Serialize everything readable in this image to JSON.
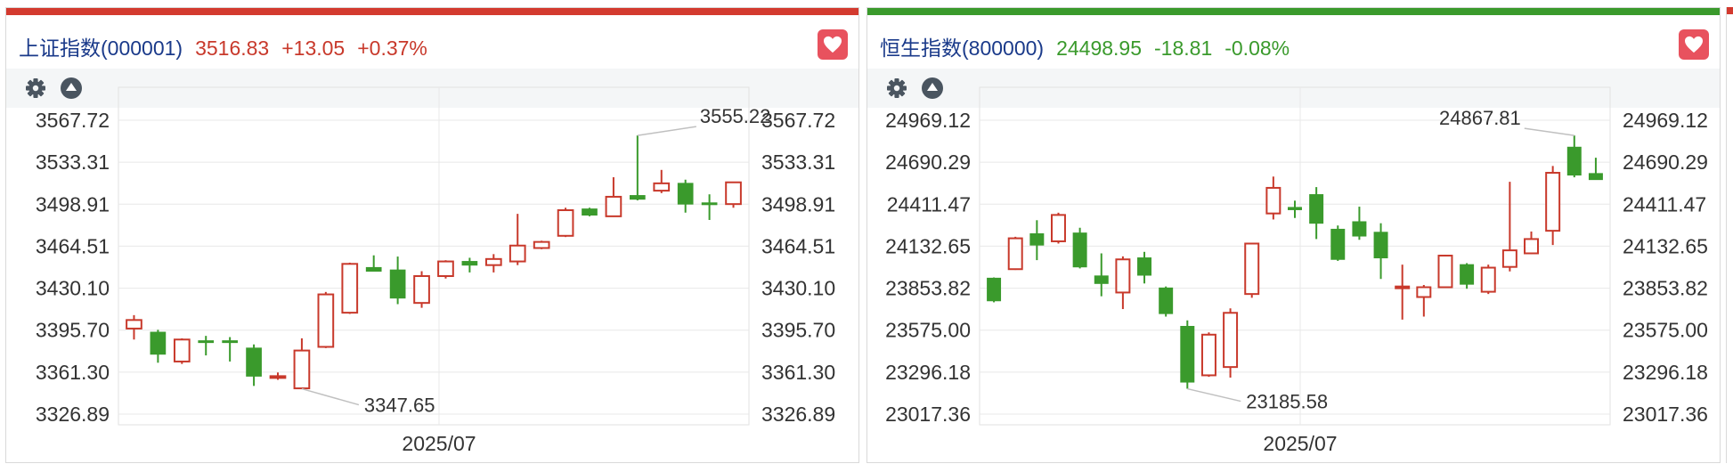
{
  "colors": {
    "up": "#c8392b",
    "down": "#3a9a2c",
    "up_bar": "#d33a2f",
    "down_bar": "#3a9a2c",
    "name": "#1a3a8a",
    "fav_bg": "#e8525e"
  },
  "icons": {
    "settings": "gear-icon",
    "collapse": "triangle-up-icon",
    "favorite": "heart-icon"
  },
  "panels": [
    {
      "name": "上证指数(000001)",
      "price": "3516.83",
      "change": "+13.05",
      "pct": "+0.37%",
      "direction": "up",
      "x_label": "2025/07",
      "y_ticks": [
        "3567.72",
        "3533.31",
        "3498.91",
        "3464.51",
        "3430.10",
        "3395.70",
        "3361.30",
        "3326.89"
      ],
      "high_label": "3555.22",
      "low_label": "3347.65"
    },
    {
      "name": "恒生指数(800000)",
      "price": "24498.95",
      "change": "-18.81",
      "pct": "-0.08%",
      "direction": "down",
      "x_label": "2025/07",
      "y_ticks": [
        "24969.12",
        "24690.29",
        "24411.47",
        "24132.65",
        "23853.82",
        "23575.00",
        "23296.18",
        "23017.36"
      ],
      "high_label": "24867.81",
      "low_label": "23185.58"
    }
  ],
  "chart_data": [
    {
      "type": "candlestick",
      "title": "上证指数(000001)",
      "ylim": [
        3326.89,
        3567.72
      ],
      "y_ticks": [
        3567.72,
        3533.31,
        3498.91,
        3464.51,
        3430.1,
        3395.7,
        3361.3,
        3326.89
      ],
      "x_label": "2025/07",
      "grid": true,
      "candles": [
        {
          "o": 3397,
          "h": 3408,
          "l": 3388,
          "c": 3404
        },
        {
          "o": 3394,
          "h": 3396,
          "l": 3369,
          "c": 3376
        },
        {
          "o": 3370,
          "h": 3389,
          "l": 3368,
          "c": 3388
        },
        {
          "o": 3387,
          "h": 3391,
          "l": 3375,
          "c": 3386
        },
        {
          "o": 3387,
          "h": 3390,
          "l": 3370,
          "c": 3386
        },
        {
          "o": 3381,
          "h": 3384,
          "l": 3350,
          "c": 3358
        },
        {
          "o": 3357,
          "h": 3361,
          "l": 3355,
          "c": 3358
        },
        {
          "o": 3348,
          "h": 3389,
          "l": 3347.65,
          "c": 3379
        },
        {
          "o": 3382,
          "h": 3427,
          "l": 3381,
          "c": 3425
        },
        {
          "o": 3410,
          "h": 3451,
          "l": 3409,
          "c": 3450
        },
        {
          "o": 3447,
          "h": 3457,
          "l": 3444,
          "c": 3444
        },
        {
          "o": 3445,
          "h": 3456,
          "l": 3417,
          "c": 3422
        },
        {
          "o": 3418,
          "h": 3444,
          "l": 3414,
          "c": 3440
        },
        {
          "o": 3440,
          "h": 3453,
          "l": 3438,
          "c": 3452
        },
        {
          "o": 3452,
          "h": 3455,
          "l": 3443,
          "c": 3449
        },
        {
          "o": 3449,
          "h": 3458,
          "l": 3443,
          "c": 3454
        },
        {
          "o": 3452,
          "h": 3491,
          "l": 3449,
          "c": 3465
        },
        {
          "o": 3463,
          "h": 3469,
          "l": 3462,
          "c": 3468
        },
        {
          "o": 3473,
          "h": 3496,
          "l": 3472,
          "c": 3494
        },
        {
          "o": 3495,
          "h": 3496,
          "l": 3489,
          "c": 3490
        },
        {
          "o": 3489,
          "h": 3521,
          "l": 3489,
          "c": 3505
        },
        {
          "o": 3506,
          "h": 3555.22,
          "l": 3502,
          "c": 3503
        },
        {
          "o": 3510,
          "h": 3527,
          "l": 3508,
          "c": 3516
        },
        {
          "o": 3516,
          "h": 3519,
          "l": 3492,
          "c": 3499
        },
        {
          "o": 3500,
          "h": 3507,
          "l": 3486,
          "c": 3499
        },
        {
          "o": 3499,
          "h": 3517,
          "l": 3496,
          "c": 3516.83
        }
      ]
    },
    {
      "type": "candlestick",
      "title": "恒生指数(800000)",
      "ylim": [
        23017.36,
        24969.12
      ],
      "y_ticks": [
        24969.12,
        24690.29,
        24411.47,
        24132.65,
        23853.82,
        23575.0,
        23296.18,
        23017.36
      ],
      "x_label": "2025/07",
      "grid": true,
      "candles": [
        {
          "o": 23920,
          "h": 23925,
          "l": 23760,
          "c": 23770
        },
        {
          "o": 23980,
          "h": 24195,
          "l": 23975,
          "c": 24185
        },
        {
          "o": 24215,
          "h": 24305,
          "l": 24040,
          "c": 24140
        },
        {
          "o": 24165,
          "h": 24355,
          "l": 24150,
          "c": 24340
        },
        {
          "o": 24220,
          "h": 24255,
          "l": 23985,
          "c": 23995
        },
        {
          "o": 23935,
          "h": 24085,
          "l": 23800,
          "c": 23885
        },
        {
          "o": 23825,
          "h": 24065,
          "l": 23715,
          "c": 24045
        },
        {
          "o": 24055,
          "h": 24095,
          "l": 23885,
          "c": 23940
        },
        {
          "o": 23855,
          "h": 23865,
          "l": 23665,
          "c": 23685
        },
        {
          "o": 23600,
          "h": 23640,
          "l": 23185.58,
          "c": 23230
        },
        {
          "o": 23275,
          "h": 23560,
          "l": 23265,
          "c": 23545
        },
        {
          "o": 23330,
          "h": 23720,
          "l": 23260,
          "c": 23690
        },
        {
          "o": 23815,
          "h": 24150,
          "l": 23790,
          "c": 24150
        },
        {
          "o": 24350,
          "h": 24595,
          "l": 24310,
          "c": 24520
        },
        {
          "o": 24390,
          "h": 24435,
          "l": 24320,
          "c": 24375
        },
        {
          "o": 24475,
          "h": 24525,
          "l": 24180,
          "c": 24285
        },
        {
          "o": 24245,
          "h": 24270,
          "l": 24035,
          "c": 24045
        },
        {
          "o": 24295,
          "h": 24395,
          "l": 24175,
          "c": 24200
        },
        {
          "o": 24225,
          "h": 24285,
          "l": 23915,
          "c": 24055
        },
        {
          "o": 23860,
          "h": 24010,
          "l": 23645,
          "c": 23865
        },
        {
          "o": 23795,
          "h": 23875,
          "l": 23665,
          "c": 23860
        },
        {
          "o": 23860,
          "h": 24075,
          "l": 23855,
          "c": 24070
        },
        {
          "o": 24010,
          "h": 24020,
          "l": 23850,
          "c": 23880
        },
        {
          "o": 23830,
          "h": 24010,
          "l": 23815,
          "c": 23990
        },
        {
          "o": 23995,
          "h": 24560,
          "l": 23965,
          "c": 24105
        },
        {
          "o": 24085,
          "h": 24230,
          "l": 24080,
          "c": 24180
        },
        {
          "o": 24235,
          "h": 24665,
          "l": 24140,
          "c": 24620
        },
        {
          "o": 24790,
          "h": 24867.81,
          "l": 24590,
          "c": 24605
        },
        {
          "o": 24615,
          "h": 24720,
          "l": 24580,
          "c": 24575
        }
      ]
    }
  ]
}
